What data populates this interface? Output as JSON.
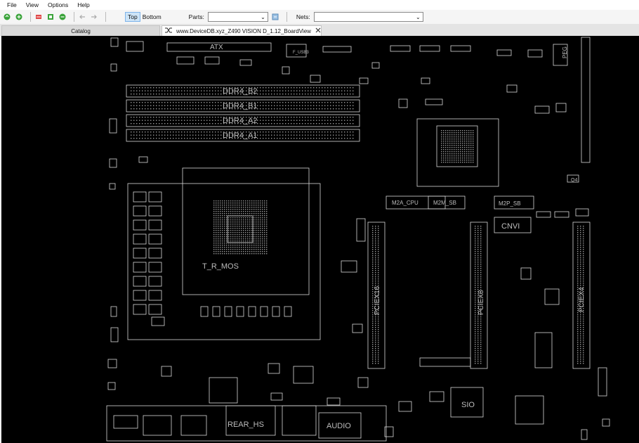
{
  "menu": [
    "File",
    "View",
    "Options",
    "Help"
  ],
  "toolbar": {
    "icons": [
      "refresh-icon",
      "zoom-in-icon",
      "flip-icon",
      "fit-icon",
      "zoom-out-icon",
      "back-arrow-icon",
      "forward-arrow-icon"
    ],
    "top_label": "Top",
    "bottom_label": "Bottom",
    "parts_label": "Parts:",
    "parts_value": "",
    "nets_label": "Nets:",
    "nets_value": ""
  },
  "tabs": {
    "catalog": "Catalog",
    "board": "www.DeviceDB.xyz_Z490 VISION D_1.12_BoardView"
  },
  "board": {
    "atx": "ATX",
    "f_usb3": "F_USB3",
    "ddr": [
      "DDR4_B2",
      "DDR4_B1",
      "DDR4_A2",
      "DDR4_A1"
    ],
    "socket": "T_R_MOS",
    "peg": "PEG",
    "m2a": "M2A_CPU",
    "m2m": "M2M_SB",
    "m2p": "M2P_SB",
    "cnvi": "CNVI",
    "q4": "Q4",
    "pciex16": "PCIEX16",
    "pciex8": "PCIEX8",
    "pciex4": "PCIEX4",
    "sio": "SIO",
    "rear_hs": "REAR_HS",
    "audio": "AUDIO"
  },
  "colors": {
    "canvas": "#000000",
    "outline": "#d8d8d8",
    "label": "#bdbdbd"
  }
}
